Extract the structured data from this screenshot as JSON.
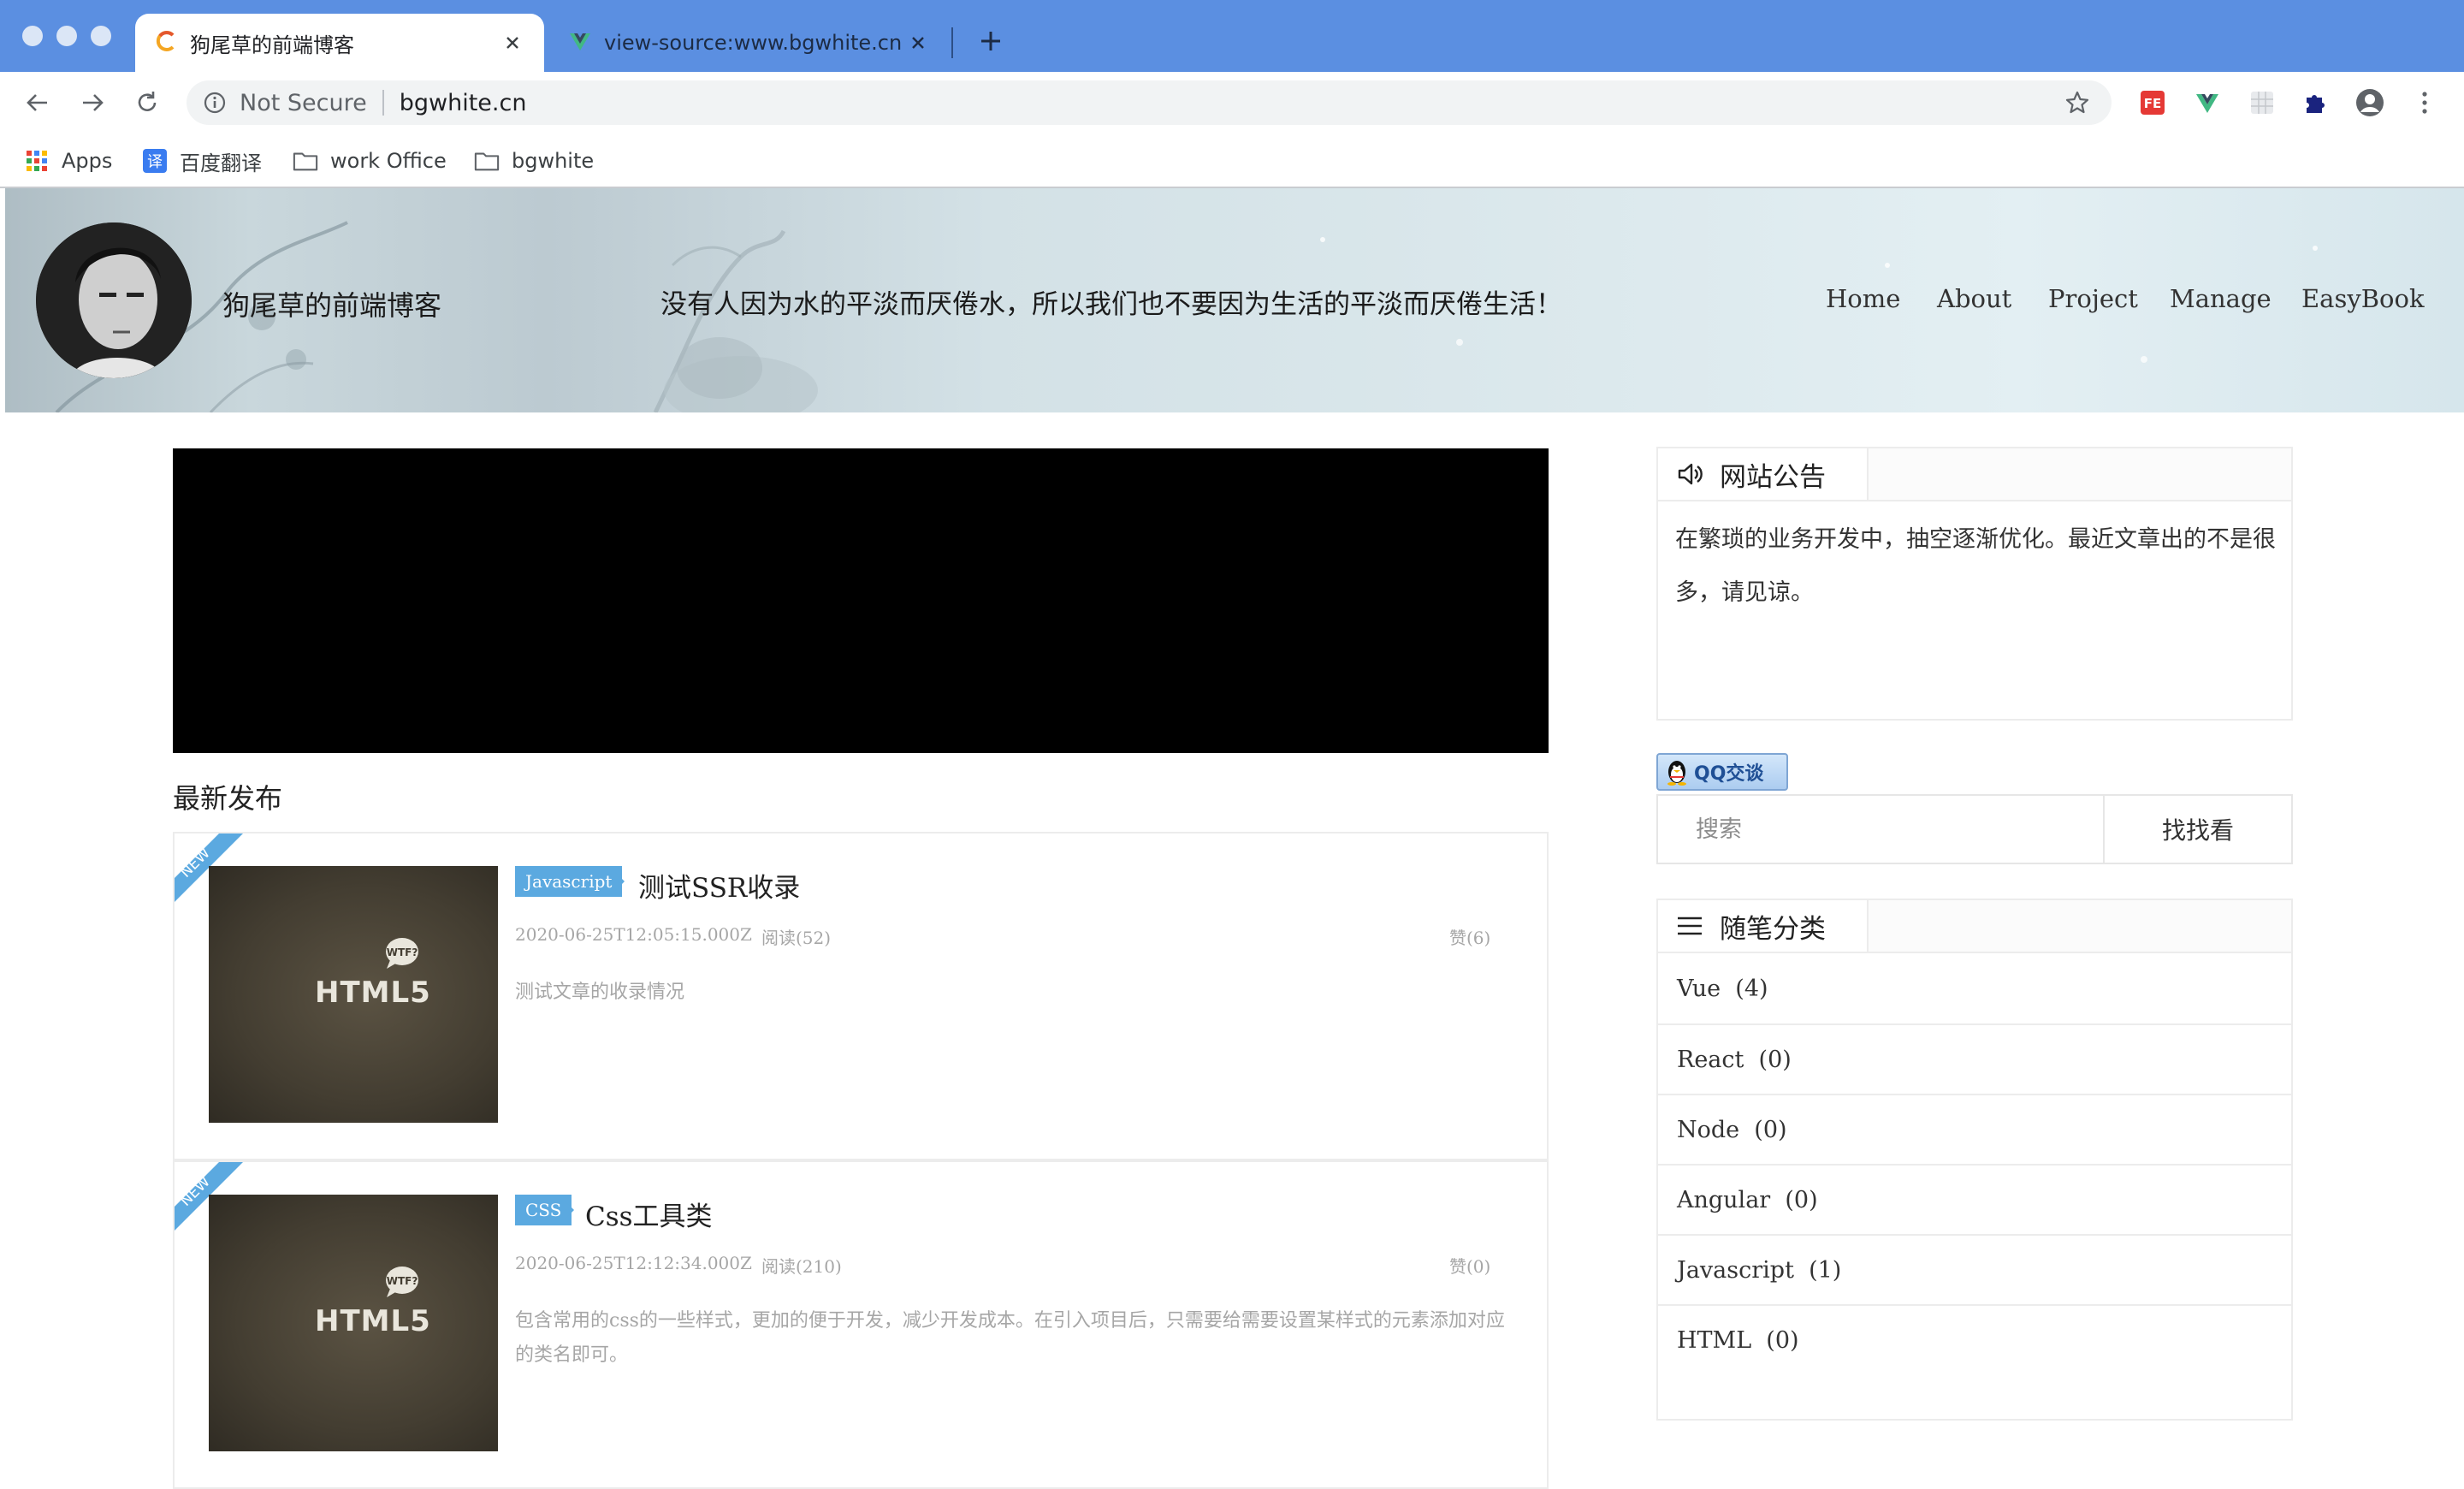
{
  "browser": {
    "tabs": [
      {
        "title": "狗尾草的前端博客",
        "active": true
      },
      {
        "title": "view-source:www.bgwhite.cn",
        "active": false
      }
    ],
    "address": {
      "security_label": "Not Secure",
      "url": "bgwhite.cn"
    },
    "bookmarks": [
      {
        "label": "Apps",
        "icon": "apps-grid-icon"
      },
      {
        "label": "百度翻译",
        "icon": "translate-icon"
      },
      {
        "label": "work Office",
        "icon": "folder-icon"
      },
      {
        "label": "bgwhite",
        "icon": "folder-icon"
      }
    ],
    "extensions": [
      "fe-extension-icon",
      "vue-devtools-icon",
      "extension-grid-icon",
      "puzzle-icon",
      "profile-icon",
      "menu-dots-icon"
    ]
  },
  "site": {
    "title": "狗尾草的前端博客",
    "motto": "没有人因为水的平淡而厌倦水，所以我们也不要因为生活的平淡而厌倦生活！",
    "nav": [
      "Home",
      "About",
      "Project",
      "Manage",
      "EasyBook"
    ]
  },
  "main": {
    "section_title": "最新发布",
    "posts": [
      {
        "tag": "Javascript",
        "title": "测试SSR收录",
        "date": "2020-06-25T12:05:15.000Z",
        "reads": "阅读(52)",
        "likes": "赞(6)",
        "excerpt": "测试文章的收录情况",
        "thumb_text": "HTML5",
        "ribbon": "NEW"
      },
      {
        "tag": "CSS",
        "title": "Css工具类",
        "date": "2020-06-25T12:12:34.000Z",
        "reads": "阅读(210)",
        "likes": "赞(0)",
        "excerpt": "包含常用的css的一些样式，更加的便于开发，减少开发成本。在引入项目后，只需要给需要设置某样式的元素添加对应的类名即可。",
        "thumb_text": "HTML5",
        "ribbon": "NEW"
      }
    ]
  },
  "sidebar": {
    "notice": {
      "title": "网站公告",
      "text": "在繁琐的业务开发中，抽空逐渐优化。最近文章出的不是很多，请见谅。"
    },
    "qq_button": "QQ交谈",
    "search": {
      "placeholder": "搜索",
      "button": "找找看"
    },
    "categories": {
      "title": "随笔分类",
      "items": [
        "Vue  (4)",
        "React  (0)",
        "Node  (0)",
        "Angular  (0)",
        "Javascript  (1)",
        "HTML  (0)"
      ]
    }
  },
  "colors": {
    "tabstrip": "#5b8fe1",
    "tag": "#5ba9e0",
    "ribbon": "#5ba9e0"
  }
}
